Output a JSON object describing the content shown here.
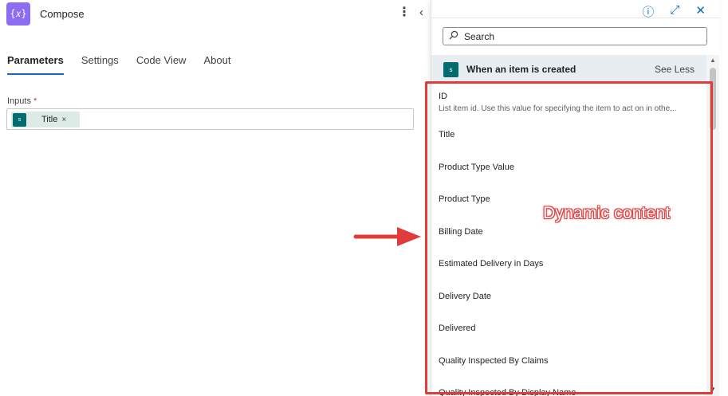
{
  "compose": {
    "icon_glyph": "{𝑥}",
    "title": "Compose",
    "more_icon": "⋮",
    "collapse_icon": "‹",
    "tabs": [
      {
        "label": "Parameters",
        "active": true
      },
      {
        "label": "Settings",
        "active": false
      },
      {
        "label": "Code View",
        "active": false
      },
      {
        "label": "About",
        "active": false
      }
    ],
    "inputs_label": "Inputs",
    "required_mark": "*",
    "token": {
      "icon_text": "s",
      "label": "Title",
      "remove": "×"
    }
  },
  "flyout": {
    "info_icon": "ⓘ",
    "expand_icon": "⤢",
    "close_icon": "✕",
    "search_placeholder": "Search",
    "group": {
      "icon_text": "s",
      "title": "When an item is created",
      "toggle": "See Less"
    },
    "items": [
      {
        "title": "ID",
        "description": "List item id. Use this value for specifying the item to act on in othe..."
      },
      {
        "title": "Title"
      },
      {
        "title": "Product Type Value"
      },
      {
        "title": "Product Type"
      },
      {
        "title": "Billing Date"
      },
      {
        "title": "Estimated Delivery in Days"
      },
      {
        "title": "Delivery Date"
      },
      {
        "title": "Delivered"
      },
      {
        "title": "Quality Inspected By Claims"
      },
      {
        "title": "Quality Inspected By Display Name"
      }
    ]
  },
  "annotation": {
    "label": "Dynamic content",
    "color": "#e03c3c"
  },
  "colors": {
    "accent": "#0f6cbd",
    "compose_icon": "#8c6cf2",
    "sharepoint": "#036c70",
    "token_bg": "#dcebe6"
  }
}
